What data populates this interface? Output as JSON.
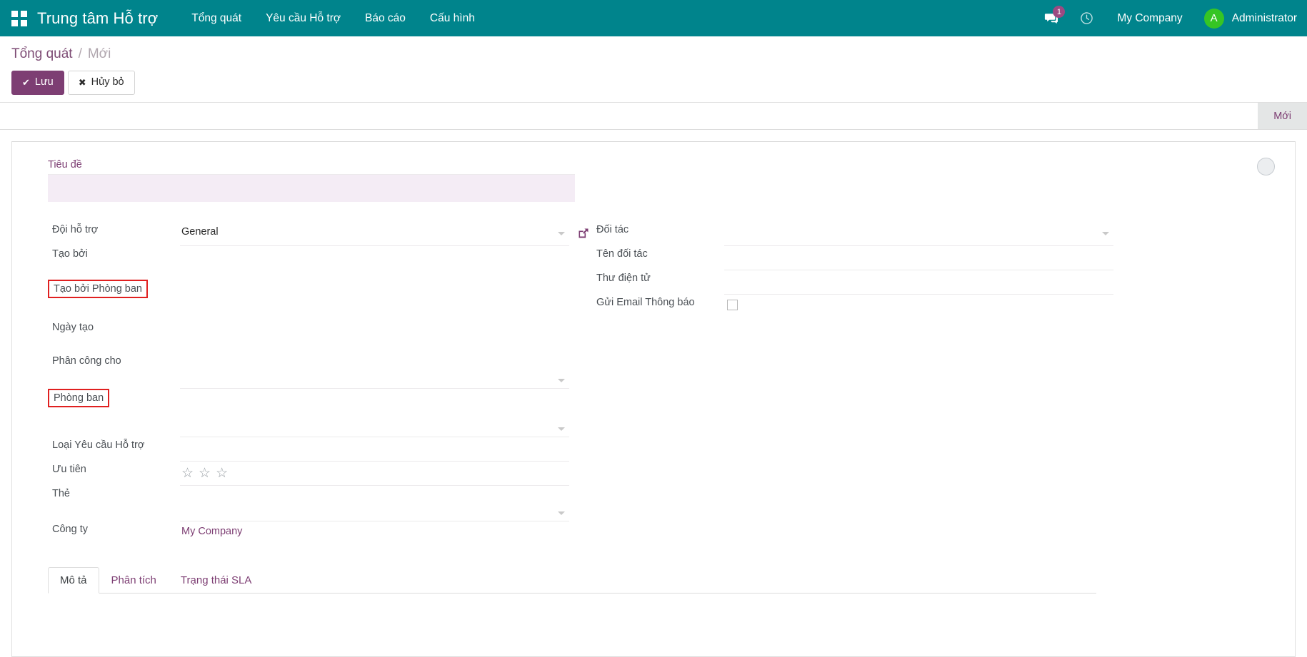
{
  "navbar": {
    "apps_icon": "apps-grid-icon",
    "brand": "Trung tâm Hỗ trợ",
    "menu": [
      {
        "label": "Tổng quát"
      },
      {
        "label": "Yêu cầu Hỗ trợ"
      },
      {
        "label": "Báo cáo"
      },
      {
        "label": "Cấu hình"
      }
    ],
    "messaging_icon": "chat-bubble-icon",
    "messaging_count": "1",
    "activity_icon": "clock-icon",
    "company": "My Company",
    "avatar_initial": "A",
    "user": "Administrator",
    "bg_color": "#00848C",
    "badge_color": "#9B4A82",
    "avatar_color": "#36C524"
  },
  "control_panel": {
    "breadcrumb_root": "Tổng quát",
    "breadcrumb_sep": "/",
    "breadcrumb_current": "Mới",
    "save_label": "Lưu",
    "save_icon": "check-icon",
    "discard_label": "Hủy bỏ",
    "discard_icon": "times-icon",
    "primary_color": "#7D3E73"
  },
  "statusbar": {
    "current": "Mới"
  },
  "form": {
    "kanban_state_icon": "kanban-state-circle-icon",
    "title": {
      "label": "Tiêu đề",
      "value": "",
      "placeholder": ""
    },
    "left_column": [
      {
        "label": "Đội hỗ trợ",
        "value": "General",
        "widget": "many2one",
        "has_caret": true,
        "has_ext_link": true,
        "marked": false
      },
      {
        "label": "Tạo bởi",
        "value": "",
        "widget": "text",
        "has_caret": false,
        "has_ext_link": false,
        "marked": false
      },
      {
        "label": "Tạo bởi Phòng ban",
        "value": "",
        "widget": "text",
        "has_caret": false,
        "has_ext_link": false,
        "marked": true
      },
      {
        "label": "Ngày tạo",
        "value": "",
        "widget": "text",
        "has_caret": false,
        "has_ext_link": false,
        "marked": false
      },
      {
        "label": "Phân công cho",
        "value": "",
        "widget": "many2one",
        "has_caret": true,
        "has_ext_link": false,
        "marked": false
      },
      {
        "label": "Phòng ban",
        "value": "",
        "widget": "many2one",
        "has_caret": true,
        "has_ext_link": false,
        "marked": true
      },
      {
        "label": "Loại Yêu cầu Hỗ trợ",
        "value": "",
        "widget": "many2one",
        "has_caret": false,
        "has_ext_link": false,
        "marked": false
      },
      {
        "label": "Ưu tiên",
        "value": "",
        "widget": "priority",
        "has_caret": false,
        "has_ext_link": false,
        "marked": false
      },
      {
        "label": "Thẻ",
        "value": "",
        "widget": "many2many",
        "has_caret": true,
        "has_ext_link": false,
        "marked": false
      },
      {
        "label": "Công ty",
        "value": "My Company",
        "widget": "link",
        "has_caret": false,
        "has_ext_link": false,
        "marked": false
      }
    ],
    "priority": {
      "stars_total": 3,
      "stars_filled": 0,
      "star_glyph": "☆"
    },
    "right_column": [
      {
        "label": "Đối tác",
        "value": "",
        "widget": "many2one",
        "has_caret": true,
        "marked": false
      },
      {
        "label": "Tên đối tác",
        "value": "",
        "widget": "text",
        "has_caret": false,
        "marked": false
      },
      {
        "label": "Thư điện tử",
        "value": "",
        "widget": "text",
        "has_caret": false,
        "marked": false
      },
      {
        "label": "Gửi Email Thông báo",
        "value": "",
        "widget": "checkbox",
        "checked": false,
        "has_caret": false,
        "marked": false
      }
    ],
    "notebook": {
      "tabs": [
        {
          "label": "Mô tả",
          "active": true
        },
        {
          "label": "Phân tích",
          "active": false
        },
        {
          "label": "Trạng thái SLA",
          "active": false
        }
      ]
    }
  }
}
